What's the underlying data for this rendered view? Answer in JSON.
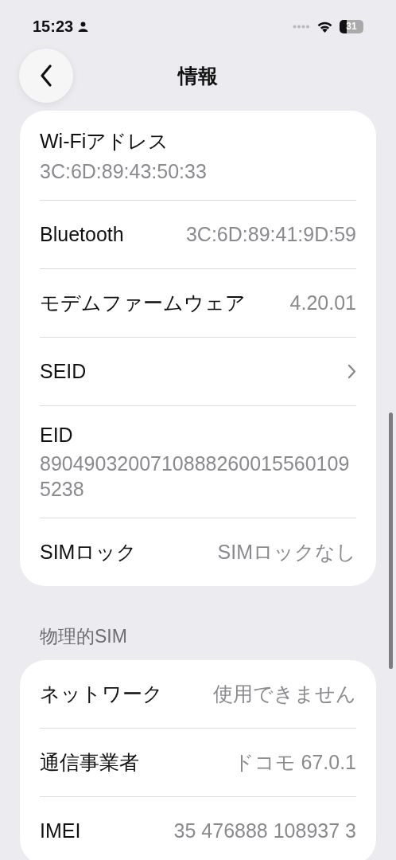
{
  "status_bar": {
    "time": "15:23",
    "battery": "31"
  },
  "nav": {
    "title": "情報"
  },
  "sections": [
    {
      "rows": [
        {
          "kind": "stacked",
          "label": "Wi-Fiアドレス",
          "value": "3C:6D:89:43:50:33"
        },
        {
          "kind": "inline",
          "label": "Bluetooth",
          "value": "3C:6D:89:41:9D:59"
        },
        {
          "kind": "inline",
          "label": "モデムファームウェア",
          "value": "4.20.01"
        },
        {
          "kind": "link",
          "label": "SEID"
        },
        {
          "kind": "stacked",
          "label": "EID",
          "value": "89049032007108882600155601095238"
        },
        {
          "kind": "inline",
          "label": "SIMロック",
          "value": "SIMロックなし"
        }
      ]
    },
    {
      "header": "物理的SIM",
      "rows": [
        {
          "kind": "inline",
          "label": "ネットワーク",
          "value": "使用できません"
        },
        {
          "kind": "inline",
          "label": "通信事業者",
          "value": "ドコモ 67.0.1"
        },
        {
          "kind": "inline",
          "label": "IMEI",
          "value": "35 476888 108937 3"
        }
      ]
    }
  ]
}
